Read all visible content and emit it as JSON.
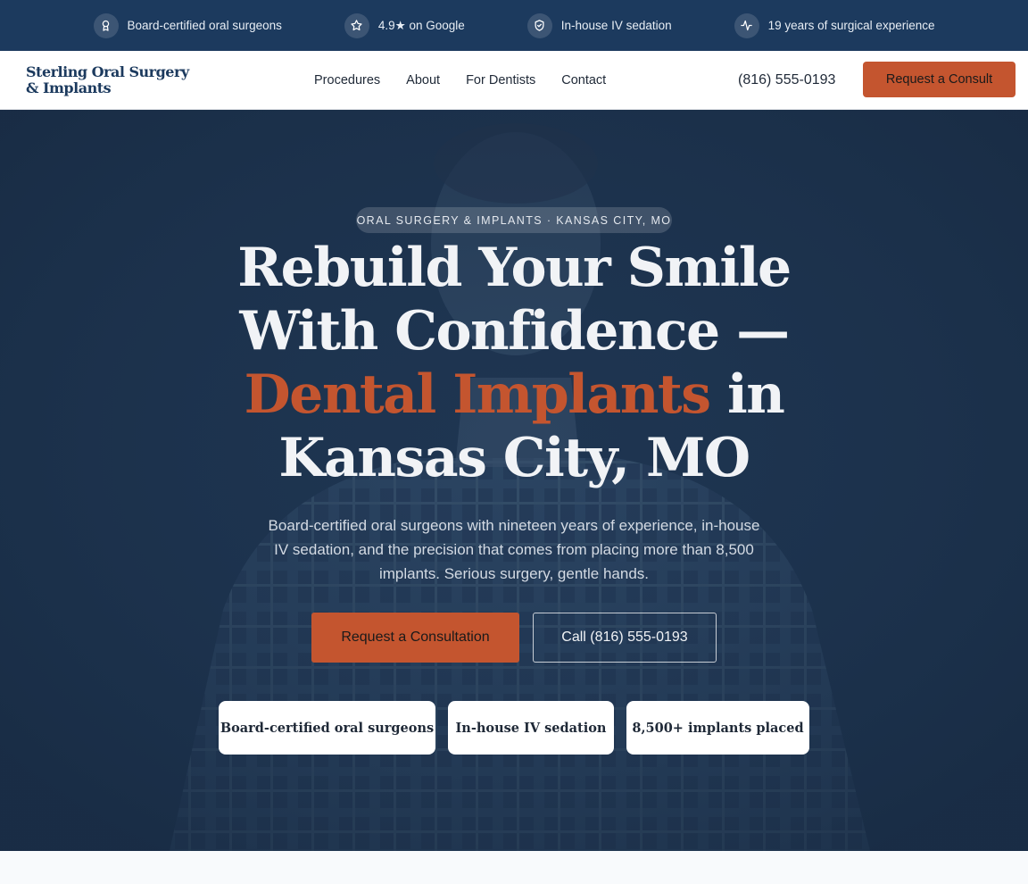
{
  "trust_bar": {
    "items": [
      {
        "icon": "award-icon",
        "label": "Board-certified oral surgeons"
      },
      {
        "icon": "star-icon",
        "label": "4.9★ on Google"
      },
      {
        "icon": "shield-check-icon",
        "label": "In-house IV sedation"
      },
      {
        "icon": "activity-icon",
        "label": "19 years of surgical experience"
      }
    ]
  },
  "header": {
    "logo": "Sterling Oral Surgery & Implants",
    "nav": [
      "Procedures",
      "About",
      "For Dentists",
      "Contact"
    ],
    "phone": "(816) 555-0193",
    "cta": "Request a Consult"
  },
  "hero": {
    "eyebrow": "ORAL SURGERY & IMPLANTS · KANSAS CITY, MO",
    "headline_part1": "Rebuild Your Smile With Confidence —",
    "headline_accent": "Dental Implants",
    "headline_part2": "in Kansas City, MO",
    "subtext": "Board-certified oral surgeons with nineteen years of experience, in-house IV sedation, and the precision that comes from placing more than 8,500 implants. Serious surgery, gentle hands.",
    "primary_cta": "Request a Consultation",
    "secondary_cta": "Call (816) 555-0193",
    "badges": [
      "Board-certified oral surgeons",
      "In-house IV sedation",
      "8,500+ implants placed"
    ]
  },
  "colors": {
    "navy": "#1c3a5e",
    "accent": "#c4552f",
    "hero_overlay": "#1e3551"
  }
}
